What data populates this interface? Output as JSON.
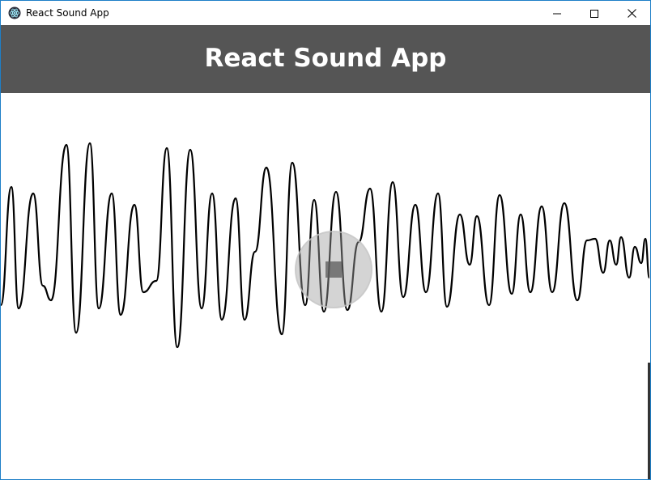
{
  "window": {
    "title": "React Sound App",
    "icon": "electron-atom-icon"
  },
  "header": {
    "title": "React Sound App",
    "background": "#555555"
  },
  "player": {
    "control_icon": "stop-icon",
    "state": "playing"
  },
  "waveform": {
    "stroke": "#000000"
  }
}
